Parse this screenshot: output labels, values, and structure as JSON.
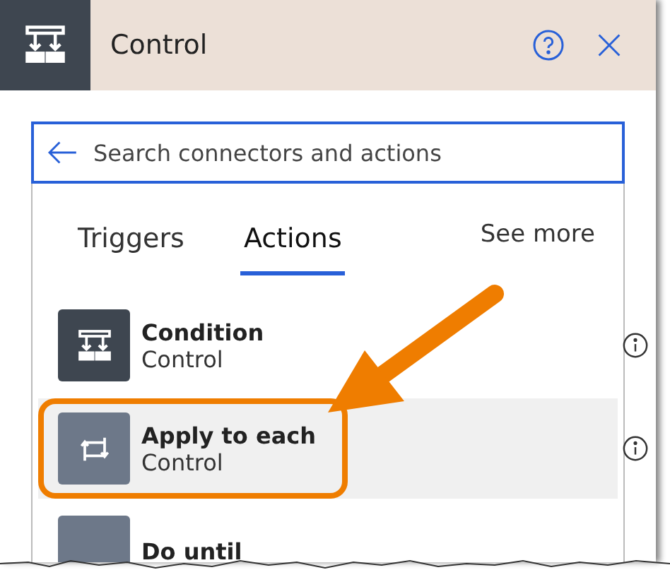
{
  "header": {
    "title": "Control",
    "kind": "condition"
  },
  "search": {
    "placeholder": "Search connectors and actions"
  },
  "tabs": [
    {
      "label": "Triggers",
      "selected": false
    },
    {
      "label": "Actions",
      "selected": true
    }
  ],
  "see_more": "See more",
  "actions": [
    {
      "name": "Condition",
      "connector": "Control",
      "kind": "condition",
      "selected": false,
      "annotated": false
    },
    {
      "name": "Apply to each",
      "connector": "Control",
      "kind": "loop",
      "selected": true,
      "annotated": true
    },
    {
      "name": "Do until",
      "kind": "loop",
      "selected": false,
      "annotated": false
    }
  ]
}
